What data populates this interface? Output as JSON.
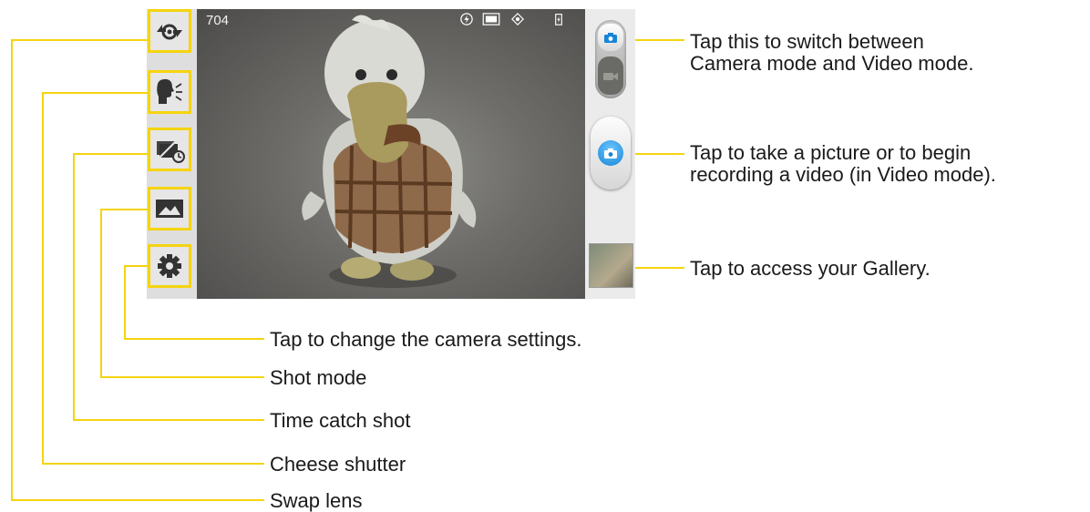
{
  "screen": {
    "shot_counter": "704",
    "status_icons": [
      "flash-auto-icon",
      "resolution-5m-icon",
      "focus-auto-icon",
      "battery-charging-icon"
    ],
    "left_icons": [
      "swap-lens-icon",
      "cheese-shutter-icon",
      "time-catch-shot-icon",
      "shot-mode-icon",
      "settings-gear-icon"
    ]
  },
  "callouts": {
    "mode_switch_line1": "Tap this to switch between",
    "mode_switch_line2": "Camera mode and Video mode.",
    "capture_line1": "Tap to take a picture or to begin",
    "capture_line2": "recording a video (in Video mode).",
    "gallery": "Tap to access your Gallery.",
    "settings": "Tap to change the camera settings.",
    "shot_mode": "Shot mode",
    "time_catch": "Time catch shot",
    "cheese": "Cheese shutter",
    "swap_lens": "Swap lens"
  },
  "colors": {
    "callout_line": "#f5d40f",
    "shutter_blue": "#1685d6"
  }
}
